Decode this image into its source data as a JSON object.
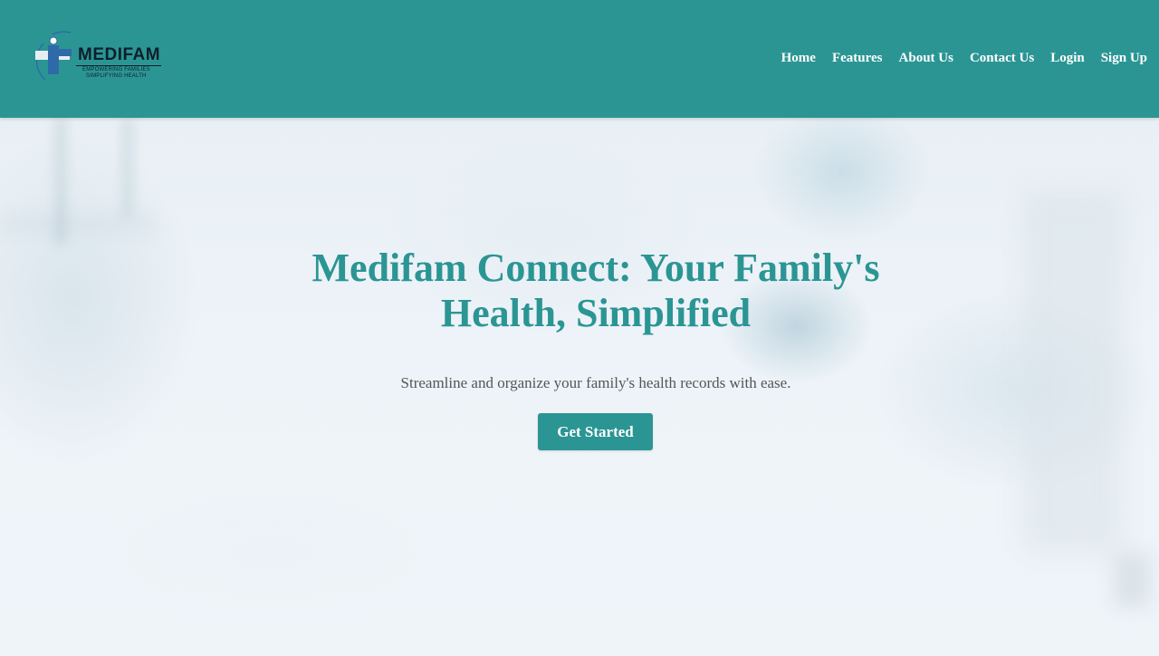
{
  "colors": {
    "brand_teal": "#2b9594",
    "page_background": "#eef3f7",
    "nav_text": "#ffffff",
    "subtitle_text": "#555555",
    "logo_dark": "#0d1f2b",
    "logo_blue": "#2f6aa8"
  },
  "header": {
    "logo": {
      "wordmark": "MEDIFAM",
      "tagline_line1": "EMPOWERING FAMILIES",
      "tagline_line2": "SIMPLIFYING HEALTH",
      "icon": "medifam-logo-icon"
    },
    "nav": {
      "items": [
        {
          "label": "Home"
        },
        {
          "label": "Features"
        },
        {
          "label": "About Us"
        },
        {
          "label": "Contact Us"
        },
        {
          "label": "Login"
        },
        {
          "label": "Sign Up"
        }
      ]
    }
  },
  "hero": {
    "title": "Medifam Connect: Your Family's Health, Simplified",
    "subtitle": "Streamline and organize your family's health records with ease.",
    "cta_label": "Get Started"
  }
}
